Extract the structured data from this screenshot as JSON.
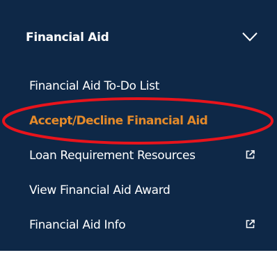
{
  "menu": {
    "section_title": "Financial Aid",
    "items": [
      {
        "label": "Financial Aid To-Do List",
        "active": false,
        "external": false
      },
      {
        "label": "Accept/Decline Financial Aid",
        "active": true,
        "external": false
      },
      {
        "label": "Loan Requirement Resources",
        "active": false,
        "external": true
      },
      {
        "label": "View Financial Aid Award",
        "active": false,
        "external": false
      },
      {
        "label": "Financial Aid Info",
        "active": false,
        "external": true
      }
    ]
  },
  "colors": {
    "panel_bg": "#0e2847",
    "text": "#ffffff",
    "active_text": "#e48a2a",
    "annotation": "#e8141c"
  },
  "icons": {
    "expand": "chevron-down-icon",
    "external": "external-link-icon"
  }
}
